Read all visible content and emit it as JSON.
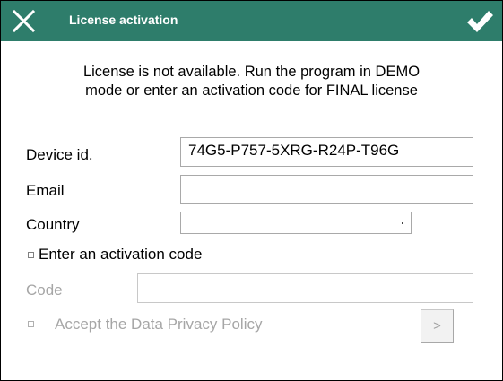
{
  "titlebar": {
    "title": "License activation",
    "close_icon": "close-icon",
    "ok_icon": "checkmark-icon",
    "background": "#2e7d6b"
  },
  "message": {
    "line1": "License is not available. Run the program in DEMO",
    "line2": "mode or enter an activation code for FINAL license"
  },
  "form": {
    "device_id_label": "Device id.",
    "device_id_value": "74G5-P757-5XRG-R24P-T96G",
    "email_label": "Email",
    "email_value": "",
    "country_label": "Country",
    "country_value": "",
    "activation_checkbox_label": "Enter an activation code",
    "activation_checked": false,
    "code_label": "Code",
    "code_value": "",
    "privacy_checkbox_label": "Accept the Data Privacy Policy",
    "privacy_checked": false,
    "next_button_label": ">"
  }
}
